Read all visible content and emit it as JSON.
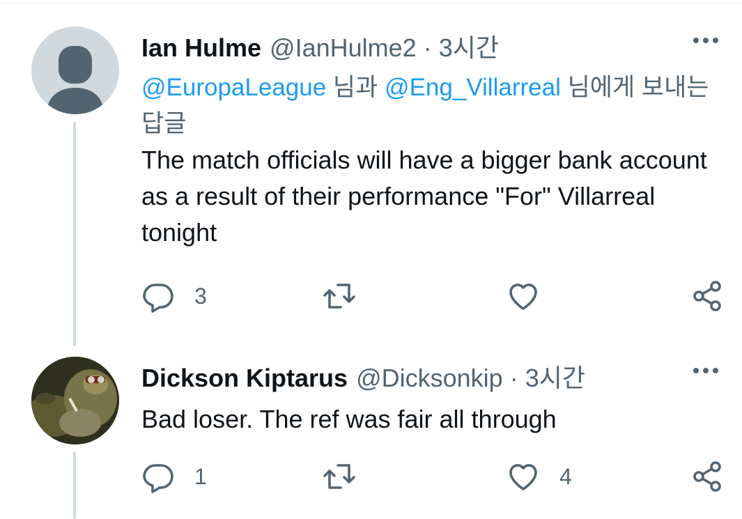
{
  "tweets": [
    {
      "name": "Ian Hulme",
      "handle": "@IanHulme2",
      "separator": "·",
      "time": "3시간",
      "reply_mention_1": "@EuropaLeague",
      "reply_mid": " 님과 ",
      "reply_mention_2": "@Eng_Villarreal",
      "reply_tail": " 님에게 보내는 답글",
      "text": "The match officials will have a bigger bank account as a result of their performance \"For\" Villarreal tonight",
      "reply_count": "3",
      "retweet_count": "",
      "like_count": ""
    },
    {
      "name": "Dickson Kiptarus",
      "handle": "@Dicksonkip",
      "separator": "·",
      "time": "3시간",
      "text": "Bad loser. The ref was fair all through",
      "reply_count": "1",
      "retweet_count": "",
      "like_count": "4"
    }
  ],
  "icons": {
    "reply": "reply-icon",
    "retweet": "retweet-icon",
    "like": "heart-icon",
    "share": "share-icon",
    "more": "more-icon"
  },
  "colors": {
    "accent": "#1d9bf0",
    "secondary_text": "#536471",
    "thread_line": "#cfd9de"
  }
}
